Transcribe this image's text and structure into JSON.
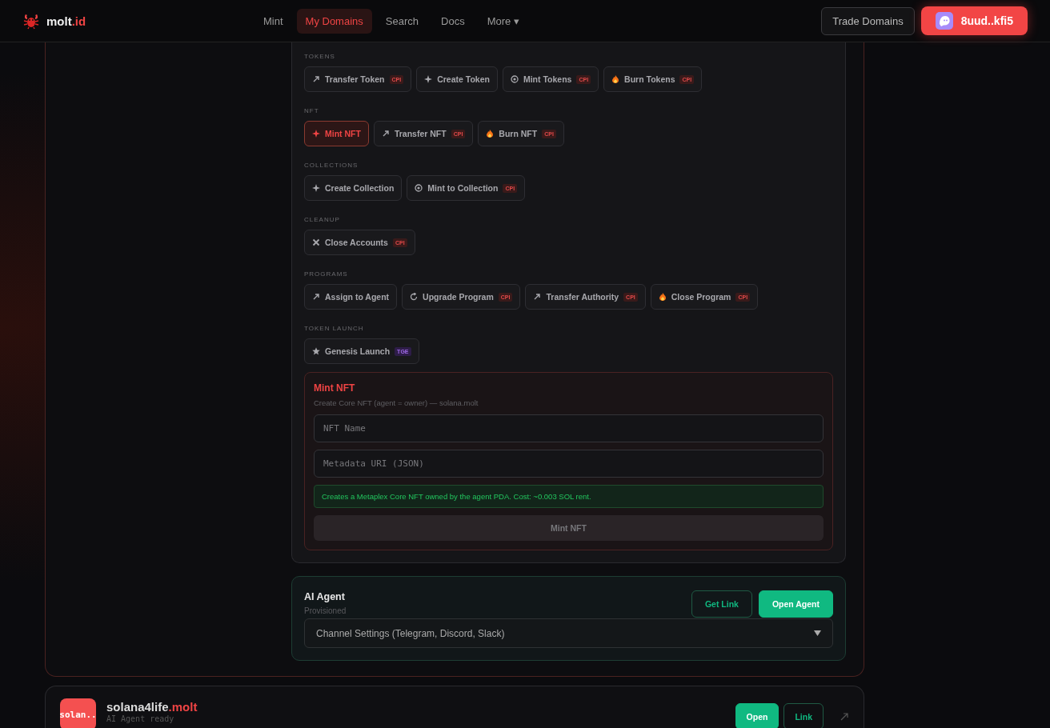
{
  "header": {
    "logo": {
      "name": "molt",
      "suffix": ".id"
    },
    "nav": [
      {
        "label": "Mint",
        "selected": false
      },
      {
        "label": "My Domains",
        "selected": true
      },
      {
        "label": "Search",
        "selected": false
      },
      {
        "label": "Docs",
        "selected": false
      },
      {
        "label": "More ▾",
        "selected": false
      }
    ],
    "trade_button": "Trade Domains",
    "wallet": "8uud..kfi5"
  },
  "action_groups": [
    {
      "title": "TOKENS",
      "actions": [
        {
          "label": "Transfer Token",
          "kind": "arrow",
          "badge": {
            "text": "CPI",
            "kind": "cpi"
          },
          "selected": false
        },
        {
          "label": "Create Token",
          "kind": "sparkle",
          "selected": false
        },
        {
          "label": "Mint Tokens",
          "kind": "target",
          "badge": {
            "text": "CPI",
            "kind": "cpi"
          },
          "selected": false
        },
        {
          "label": "Burn Tokens",
          "kind": "flame",
          "badge": {
            "text": "CPI",
            "kind": "cpi"
          },
          "selected": false
        }
      ]
    },
    {
      "title": "NFT",
      "actions": [
        {
          "label": "Mint NFT",
          "kind": "sparkle",
          "selected": true
        },
        {
          "label": "Transfer NFT",
          "kind": "arrow",
          "badge": {
            "text": "CPI",
            "kind": "cpi"
          },
          "selected": false
        },
        {
          "label": "Burn NFT",
          "kind": "flame",
          "badge": {
            "text": "CPI",
            "kind": "cpi"
          },
          "selected": false
        }
      ]
    },
    {
      "title": "COLLECTIONS",
      "actions": [
        {
          "label": "Create Collection",
          "kind": "sparkle",
          "selected": false
        },
        {
          "label": "Mint to Collection",
          "kind": "target",
          "badge": {
            "text": "CPI",
            "kind": "cpi"
          },
          "selected": false
        }
      ]
    },
    {
      "title": "CLEANUP",
      "actions": [
        {
          "label": "Close Accounts",
          "kind": "cross",
          "badge": {
            "text": "CPI",
            "kind": "cpi"
          },
          "selected": false
        }
      ]
    },
    {
      "title": "PROGRAMS",
      "actions": [
        {
          "label": "Assign to Agent",
          "kind": "arrow",
          "selected": false
        },
        {
          "label": "Upgrade Program",
          "kind": "refresh",
          "badge": {
            "text": "CPI",
            "kind": "cpi"
          },
          "selected": false
        },
        {
          "label": "Transfer Authority",
          "kind": "arrow",
          "badge": {
            "text": "CPI",
            "kind": "cpi"
          },
          "selected": false
        },
        {
          "label": "Close Program",
          "kind": "flame",
          "badge": {
            "text": "CPI",
            "kind": "cpi"
          },
          "selected": false
        }
      ]
    },
    {
      "title": "TOKEN LAUNCH",
      "actions": [
        {
          "label": "Genesis Launch",
          "kind": "star",
          "badge": {
            "text": "TGE",
            "kind": "tge"
          },
          "selected": false
        }
      ]
    }
  ],
  "form": {
    "title": "Mint NFT",
    "subtitle": "Create Core NFT (agent = owner) — solana.molt",
    "fields": [
      {
        "placeholder": "NFT Name"
      },
      {
        "placeholder": "Metadata URI (JSON)"
      }
    ],
    "note": "Creates a Metaplex Core NFT owned by the agent PDA. Cost: ~0.003 SOL rent.",
    "submit": {
      "label": "Mint NFT",
      "disabled": true
    }
  },
  "agent": {
    "title": "AI Agent",
    "status": "Provisioned",
    "buttons": [
      {
        "label": "Get Link",
        "kind": "outline"
      },
      {
        "label": "Open Agent",
        "kind": "primary"
      }
    ],
    "channel_select": "Channel Settings (Telegram, Discord, Slack)"
  },
  "domain_card": {
    "avatar": "solan..",
    "name": "solana4life",
    "suffix": ".molt",
    "status": "AI Agent ready",
    "buttons": [
      {
        "label": "Open",
        "kind": "primary"
      },
      {
        "label": "Link",
        "kind": "outline"
      }
    ]
  }
}
